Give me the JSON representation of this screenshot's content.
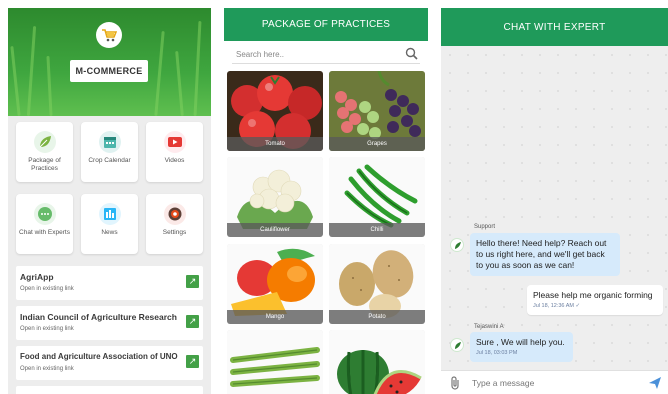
{
  "panel1": {
    "brand_label": "M-COMMERCE",
    "tiles": [
      {
        "label": "Package of Practices",
        "icon": "leaf-icon",
        "color": "#8bc34a"
      },
      {
        "label": "Crop Calendar",
        "icon": "calendar-icon",
        "color": "#4db6ac"
      },
      {
        "label": "Videos",
        "icon": "play-icon",
        "color": "#e53935"
      },
      {
        "label": "Chat with Experts",
        "icon": "chat-icon",
        "color": "#66bb6a"
      },
      {
        "label": "News",
        "icon": "news-icon",
        "color": "#29b6f6"
      },
      {
        "label": "Settings",
        "icon": "gear-icon",
        "color": "#e64a19"
      }
    ],
    "links": [
      {
        "title": "AgriApp",
        "subtitle": "Open in existing link"
      },
      {
        "title": "Indian Council of Agriculture Research",
        "subtitle": "Open in existing link"
      },
      {
        "title": "Food and Agriculture Association of UNO",
        "subtitle": "Open in existing link"
      }
    ]
  },
  "panel2": {
    "title": "PACKAGE OF PRACTICES",
    "search_placeholder": "Search here..",
    "crops": [
      "Tomato",
      "Grapes",
      "Cauliflower",
      "Chilli",
      "Mango",
      "Potato",
      "",
      ""
    ]
  },
  "panel3": {
    "title": "CHAT WITH EXPERT",
    "messages": [
      {
        "sender": "Support",
        "text": "Hello there! Need help? Reach out to us right here, and we'll get back to you as soon as we can!",
        "time": "",
        "direction": "in"
      },
      {
        "sender": "",
        "text": "Please help me organic forming",
        "time": "Jul 18, 12:36 AM  ✓",
        "direction": "out"
      },
      {
        "sender": "Tejaswini A",
        "text": "Sure , We will help you.",
        "time": "Jul 18, 03:03 PM",
        "direction": "in"
      }
    ],
    "input_placeholder": "Type a message"
  },
  "colors": {
    "primary_green": "#1f9a5a",
    "accent_green": "#43a047",
    "bubble_in": "#d6eafb"
  }
}
